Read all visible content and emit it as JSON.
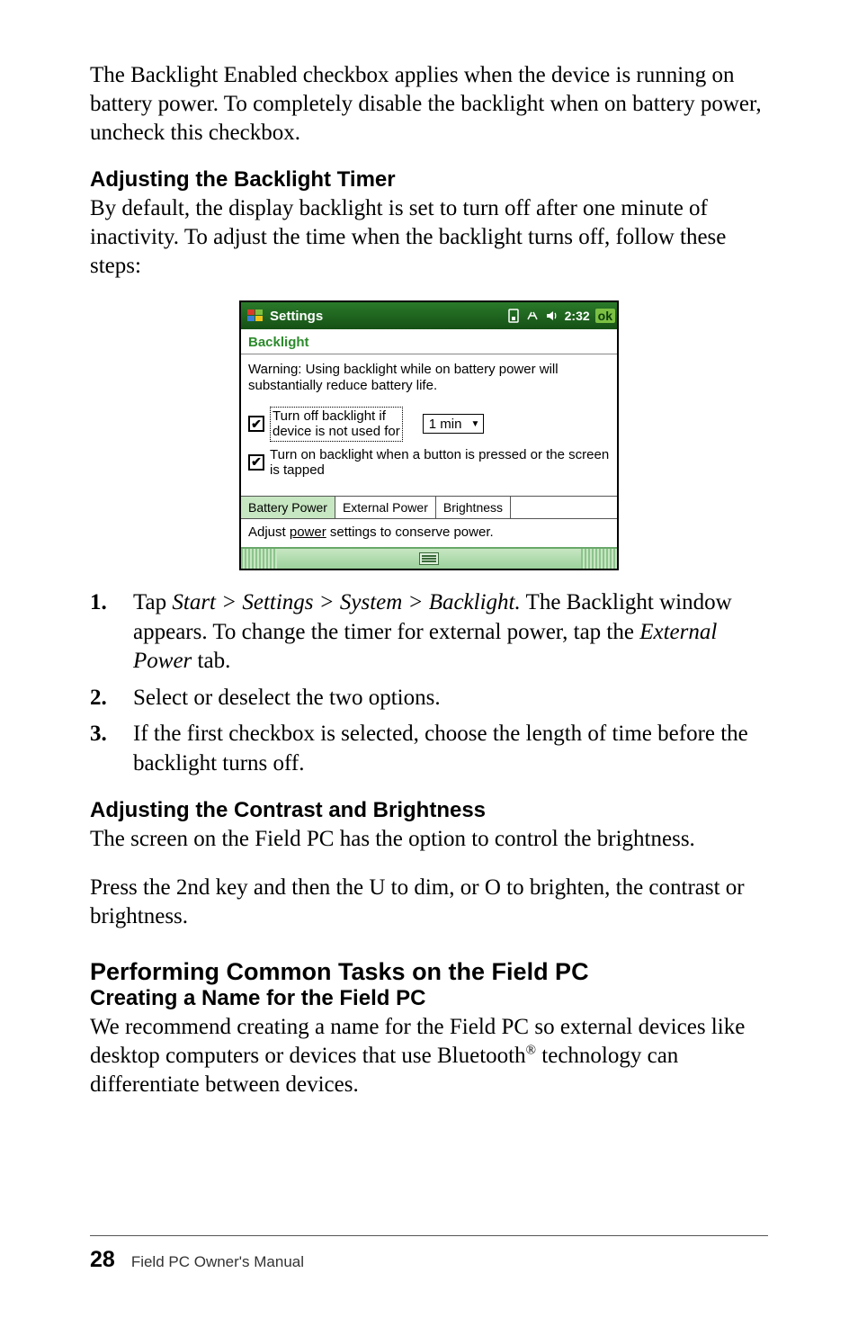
{
  "para1": "The Backlight Enabled checkbox applies when the device is running on battery power. To completely disable the backlight when on battery power, uncheck this checkbox.",
  "sub1": "Adjusting the Backlight Timer",
  "para2": "By default, the display backlight is set to turn off after one minute of inactivity. To adjust the time when the backlight turns off, follow these steps:",
  "screenshot": {
    "titlebar": {
      "title": "Settings",
      "time": "2:32",
      "ok": "ok"
    },
    "header": "Backlight",
    "warning": "Warning: Using backlight while on battery power will substantially reduce battery life.",
    "opt1_line1": "Turn off backlight if",
    "opt1_line2": "device is not used for",
    "opt1_value": "1 min",
    "opt2": "Turn on backlight when a button is pressed or the screen is tapped",
    "tabs": [
      "Battery Power",
      "External Power",
      "Brightness"
    ],
    "footnote_pre": "Adjust ",
    "footnote_link": "power",
    "footnote_post": " settings to conserve power."
  },
  "step1_a": "Tap ",
  "step1_path": "Start > Settings > System > Backlight.",
  "step1_b": " The Backlight window appears. To change the timer for external power, tap the ",
  "step1_c": "External Power",
  "step1_d": " tab.",
  "step2": "Select or deselect the two options.",
  "step3": "If the first checkbox is selected, choose the length of time before the backlight turns off.",
  "sub2": "Adjusting the Contrast and Brightness",
  "para3": "The screen on the Field PC has the option to control the brightness.",
  "para4": "Press the 2nd key and then the U to dim, or O to brighten, the contrast or brightness.",
  "sect1": "Performing Common Tasks on the Field PC",
  "sub3": "Creating a Name for the Field PC",
  "para5_a": "We recommend creating a name for the Field PC so external devices like desktop computers or devices that use Bluetooth",
  "para5_sup": "®",
  "para5_b": " technology can differentiate between devices.",
  "footer": {
    "page": "28",
    "title": "Field PC Owner's Manual"
  }
}
